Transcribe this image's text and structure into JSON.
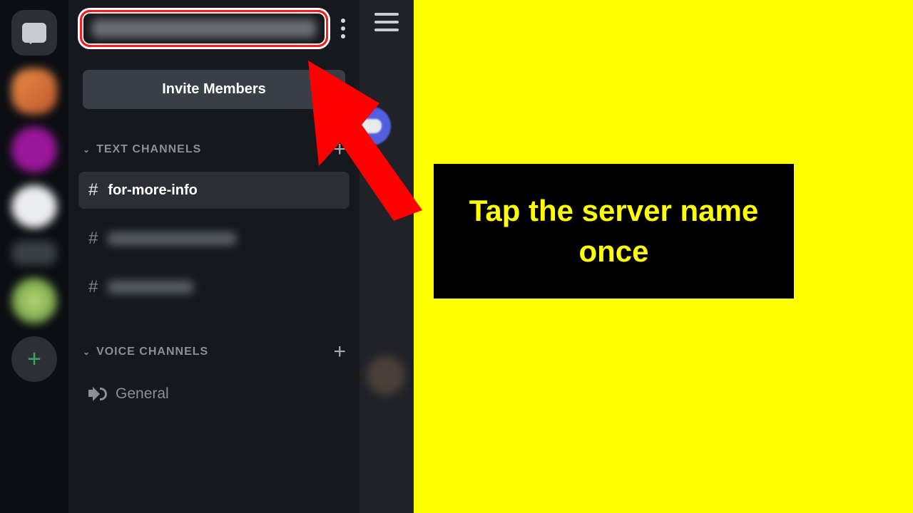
{
  "instruction_text": "Tap the server name once",
  "sidebar": {
    "invite_label": "Invite Members",
    "text_section_label": "TEXT CHANNELS",
    "voice_section_label": "VOICE CHANNELS",
    "active_channel": "for-more-info",
    "voice_channel": "General"
  }
}
